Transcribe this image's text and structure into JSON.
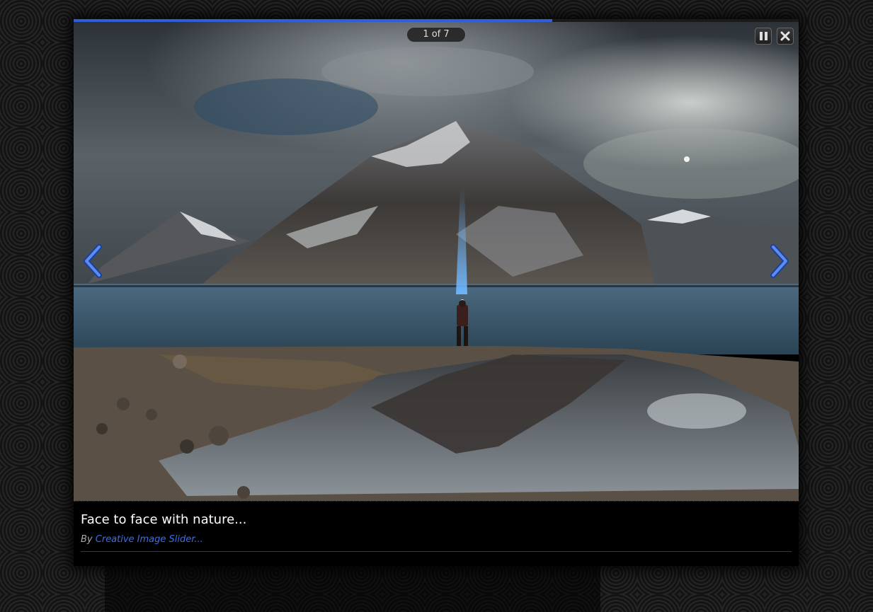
{
  "slideshow": {
    "counter": "1 of 7",
    "progress": 0.66,
    "accent_color": "#2f5fd6",
    "controls": {
      "pause_icon": "pause-icon",
      "close_icon": "close-icon",
      "prev_icon": "chevron-left-icon",
      "next_icon": "chevron-right-icon"
    }
  },
  "caption": {
    "title": "Face to face with nature...",
    "by_label": "By",
    "author_link": "Creative Image Slider..."
  }
}
